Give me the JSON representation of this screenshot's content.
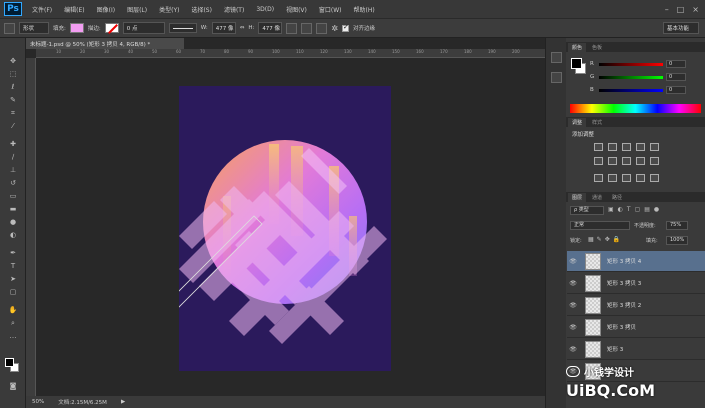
{
  "app": {
    "logo": "Ps"
  },
  "menu": [
    "文件(F)",
    "编辑(E)",
    "图像(I)",
    "图层(L)",
    "类型(Y)",
    "选择(S)",
    "滤镜(T)",
    "3D(D)",
    "视图(V)",
    "窗口(W)",
    "帮助(H)"
  ],
  "window_controls": [
    "–",
    "□",
    "×"
  ],
  "options": {
    "tool_mode": "形状",
    "fill_label": "填充:",
    "fill_color": "#f29df1",
    "stroke_label": "描边:",
    "stroke_width": "0 点",
    "w_label": "W:",
    "w_value": "477 像",
    "h_label": "H:",
    "h_value": "477 像",
    "align_edges": "对齐边缘",
    "workspace": "基本功能"
  },
  "document": {
    "tab_title": "未标题-1.psd @ 50% (矩形 3 拷贝 4, RGB/8) *",
    "zoom": "50%",
    "doc_size": "文档:2.15M/6.25M",
    "ruler_ticks": [
      "10",
      "20",
      "30",
      "40",
      "50",
      "60",
      "70",
      "80",
      "90",
      "100",
      "110",
      "120",
      "130",
      "140",
      "150",
      "160",
      "170",
      "180",
      "190",
      "200"
    ],
    "background_color": "#2b1a5c"
  },
  "panels": {
    "color_tabs": [
      "颜色",
      "色板"
    ],
    "color_channels": [
      {
        "label": "R",
        "value": "0"
      },
      {
        "label": "G",
        "value": "0"
      },
      {
        "label": "B",
        "value": "0"
      }
    ],
    "adjust_tabs": [
      "调整",
      "样式"
    ],
    "adjust_title": "添加调整",
    "layers_tabs": [
      "图层",
      "通道",
      "路径"
    ],
    "layer_filter": "ρ 类型",
    "blend_mode": "正常",
    "opacity_label": "不透明度:",
    "opacity_value": "75%",
    "lock_label": "锁定:",
    "fill_label": "填充:",
    "fill_value": "100%",
    "layers": [
      {
        "name": "矩形 3 拷贝 4",
        "selected": true
      },
      {
        "name": "矩形 3 拷贝 3",
        "selected": false
      },
      {
        "name": "矩形 3 拷贝 2",
        "selected": false
      },
      {
        "name": "矩形 3 拷贝",
        "selected": false
      },
      {
        "name": "矩形 3",
        "selected": false
      }
    ]
  },
  "watermark": {
    "line1": "小钱学设计",
    "line2": "UiBQ.CoM"
  },
  "icons": [
    "move-icon",
    "marquee-icon",
    "lasso-icon",
    "quick-select-icon",
    "crop-icon",
    "eyedropper-icon",
    "healing-icon",
    "brush-icon",
    "stamp-icon",
    "history-brush-icon",
    "eraser-icon",
    "gradient-icon",
    "blur-icon",
    "dodge-icon",
    "pen-icon",
    "type-icon",
    "path-select-icon",
    "shape-icon",
    "hand-icon",
    "zoom-icon",
    "eye-icon"
  ]
}
